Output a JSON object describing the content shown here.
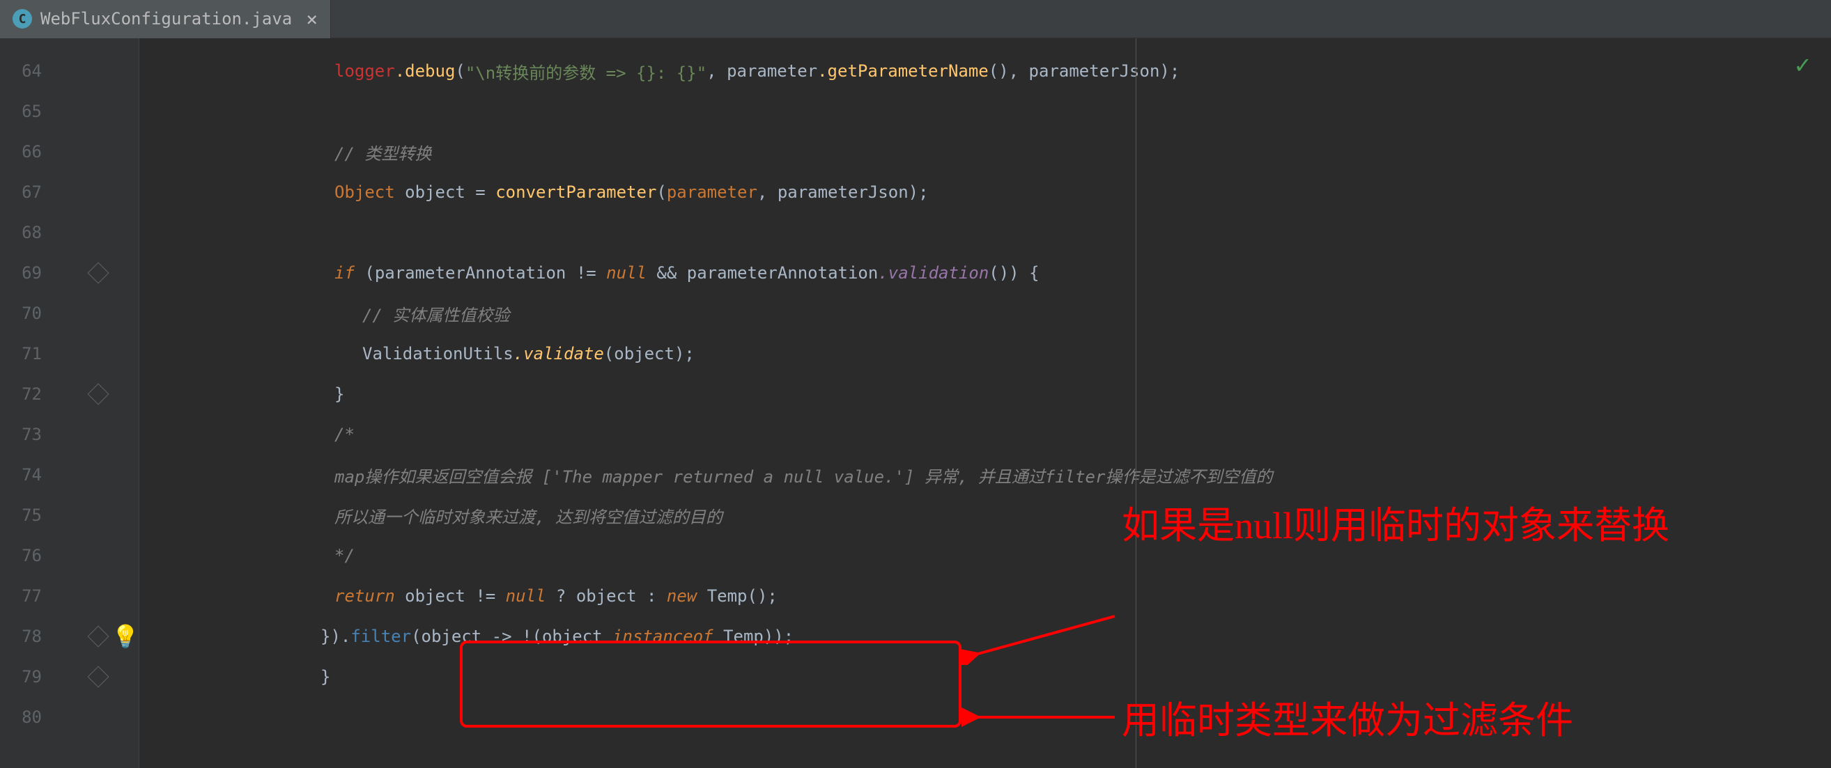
{
  "tab": {
    "filename": "WebFluxConfiguration.java",
    "icon_letter": "C"
  },
  "lines": {
    "start": 64,
    "end": 80
  },
  "code": {
    "l64_logger": "logger",
    "l64_debug": ".debug",
    "l64_str": "\"\\n转换前的参数 => {}: {}\"",
    "l64_param": "parameter",
    "l64_getpn": ".getParameterName",
    "l64_pj": "parameterJson",
    "l66_comment": "// 类型转换",
    "l67_obj": "Object",
    "l67_var": "object",
    "l67_conv": "convertParameter",
    "l67_p1": "parameter",
    "l67_p2": "parameterJson",
    "l69_if": "if",
    "l69_pa": "parameterAnnotation",
    "l69_ne": "!=",
    "l69_null": "null",
    "l69_and": "&&",
    "l69_pa2": "parameterAnnotation",
    "l69_val": ".validation",
    "l70_comment": "// 实体属性值校验",
    "l71_vu": "ValidationUtils",
    "l71_validate": ".validate",
    "l71_obj": "object",
    "l72_brace": "}",
    "l73_c": "/*",
    "l74_c": "map操作如果返回空值会报 ['The mapper returned a null value.'] 异常, 并且通过filter操作是过滤不到空值的",
    "l75_c": "所以通一个临时对象来过渡, 达到将空值过滤的目的",
    "l76_c": "*/",
    "l77_return": "return",
    "l77_obj": "object",
    "l77_ne": "!=",
    "l77_null": "null",
    "l77_q": "?",
    "l77_obj2": "object",
    "l77_colon": ":",
    "l77_new": "new",
    "l77_temp": "Temp",
    "l78_rb": "}).",
    "l78_filter": "filter",
    "l78_obj": "object",
    "l78_arrow": "->",
    "l78_not": "!(",
    "l78_obj2": "object",
    "l78_inst": "instanceof",
    "l78_temp": "Temp",
    "l79_brace": "}"
  },
  "annotations": {
    "a1": "如果是null则用临时的对象来替换",
    "a2": "用临时类型来做为过滤条件"
  },
  "icons": {
    "bulb": "💡",
    "check": "✓",
    "close": "×"
  }
}
